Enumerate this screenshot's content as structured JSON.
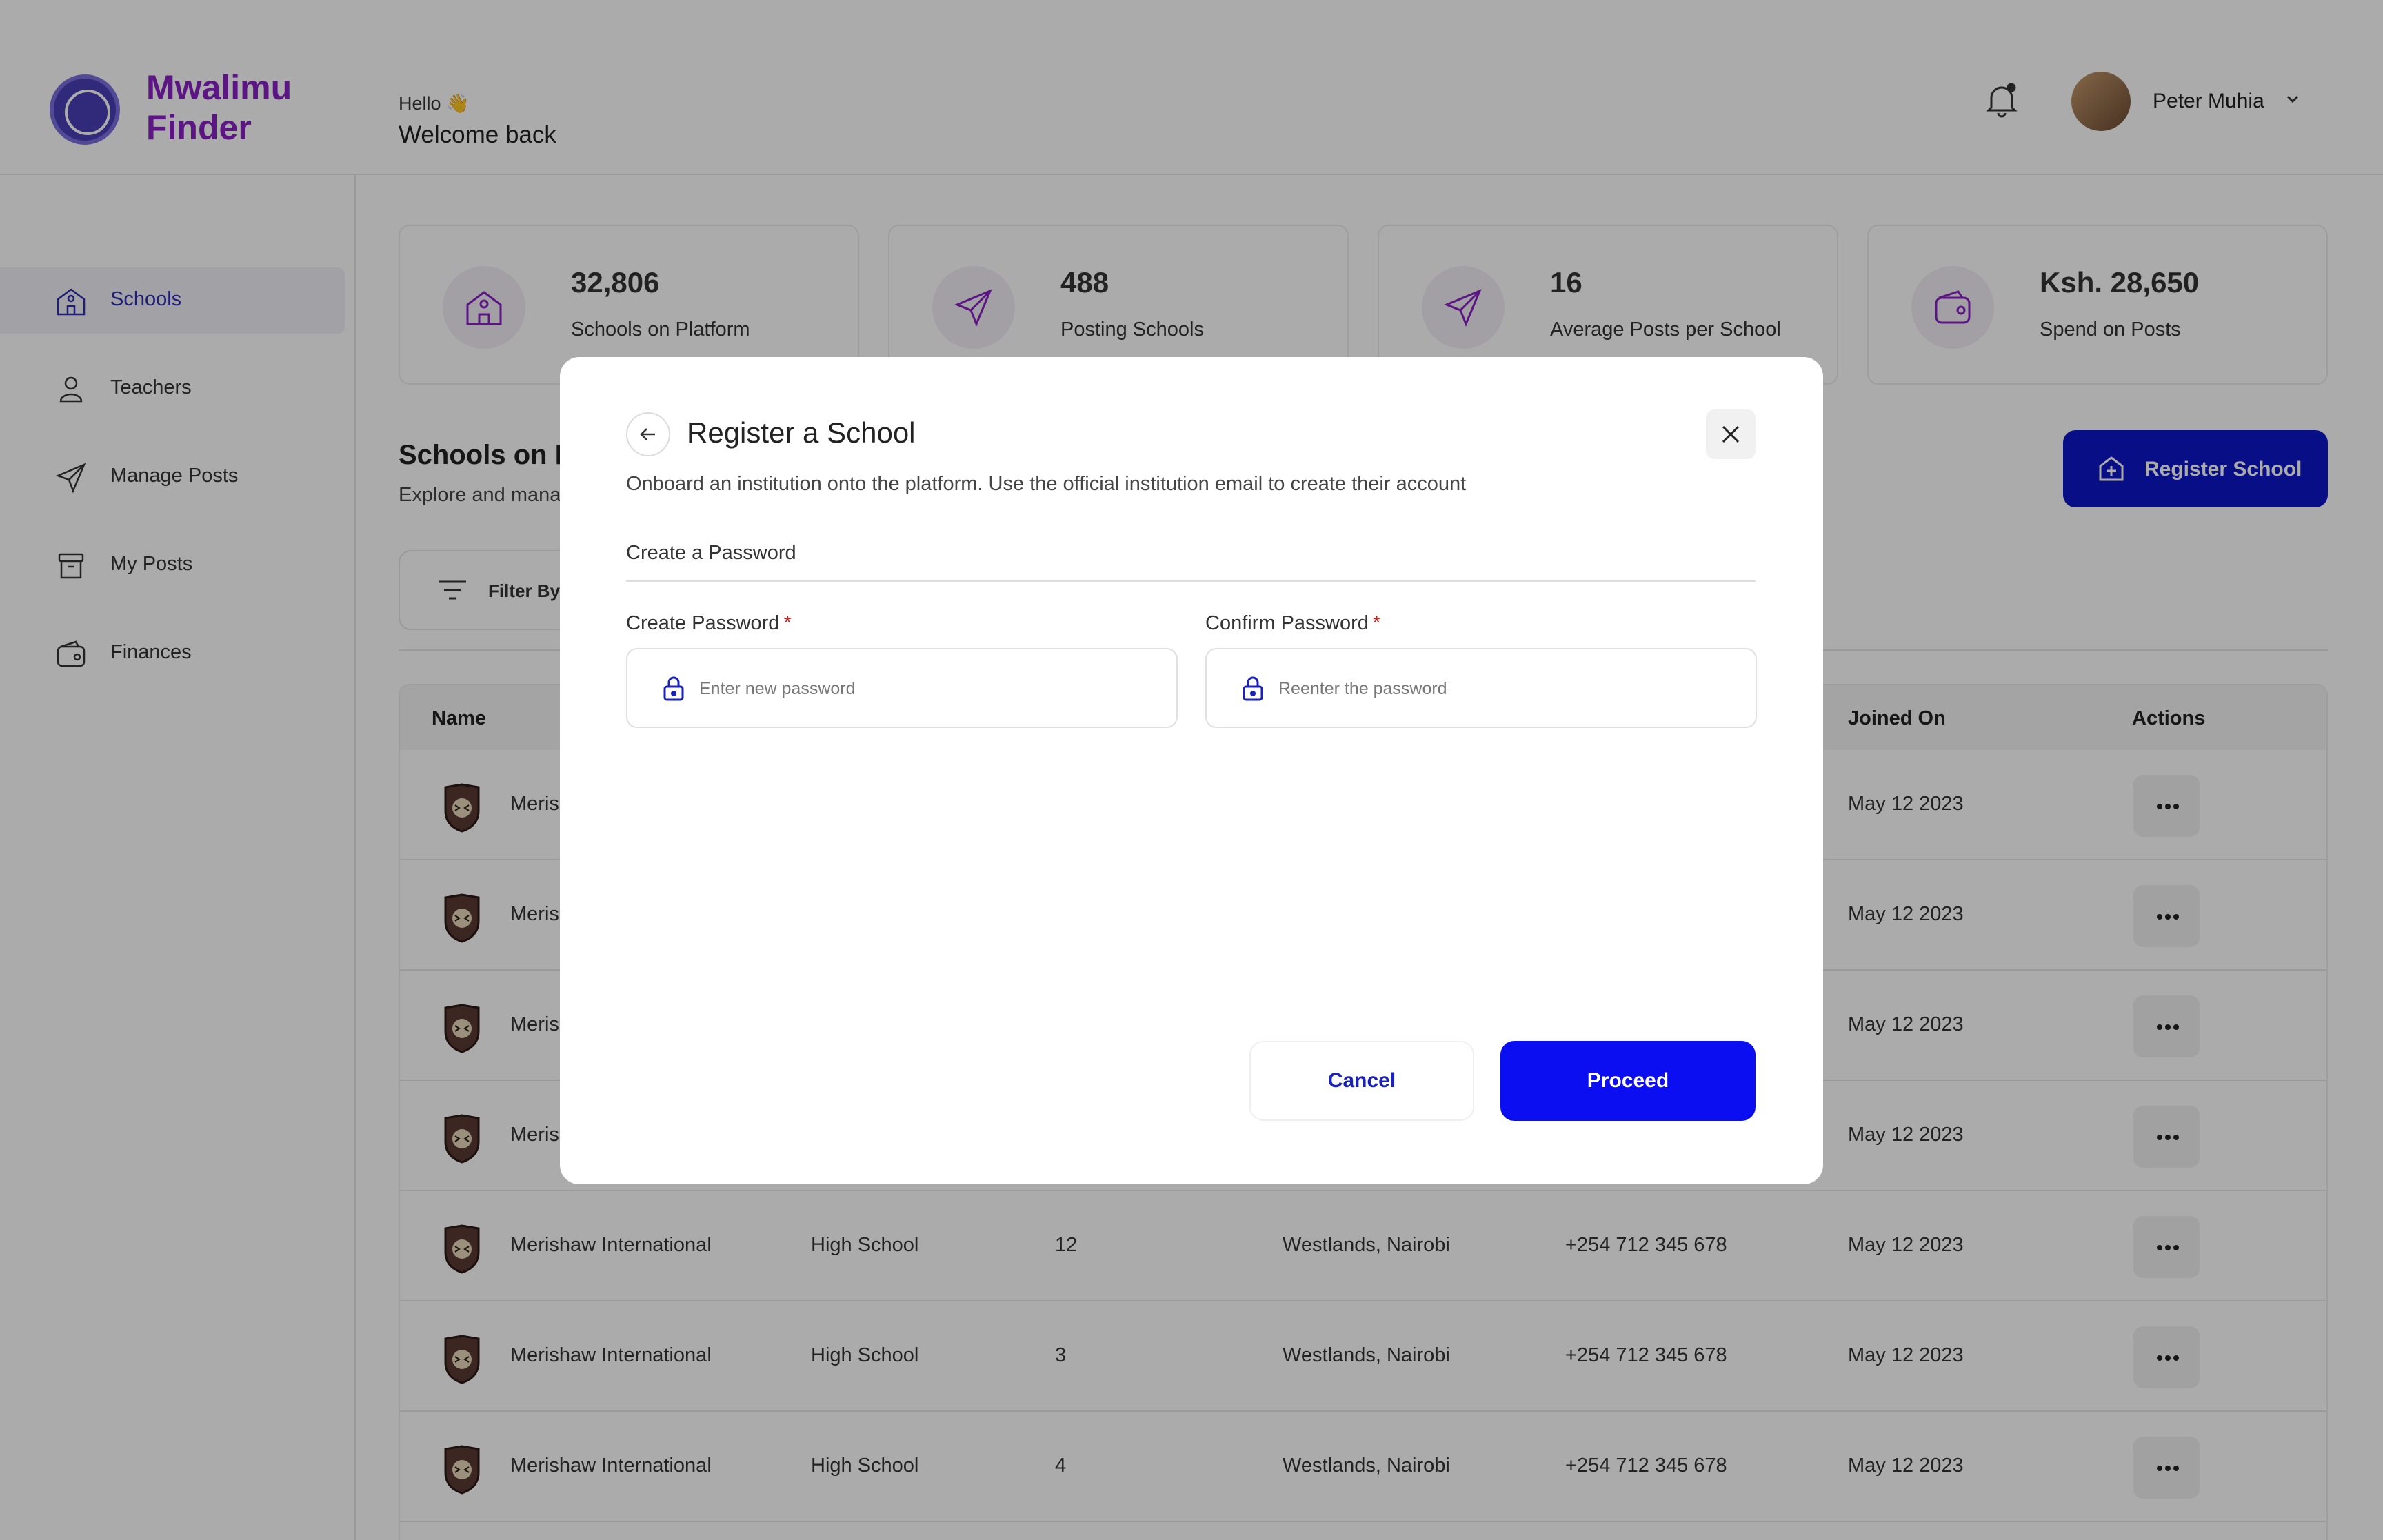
{
  "brand": {
    "name": "Mwalimu Finder"
  },
  "header": {
    "greeting_small": "Hello 👋",
    "greeting_big": "Welcome back",
    "user_name": "Peter Muhia"
  },
  "sidebar": {
    "items": [
      {
        "label": "Schools",
        "icon": "school-icon",
        "active": true
      },
      {
        "label": "Teachers",
        "icon": "user-icon",
        "active": false
      },
      {
        "label": "Manage Posts",
        "icon": "send-icon",
        "active": false
      },
      {
        "label": "My Posts",
        "icon": "archive-icon",
        "active": false
      },
      {
        "label": "Finances",
        "icon": "wallet-icon",
        "active": false
      }
    ]
  },
  "stats": [
    {
      "value": "32,806",
      "label": "Schools on Platform",
      "icon": "school-icon"
    },
    {
      "value": "488",
      "label": "Posting Schools",
      "icon": "send-icon"
    },
    {
      "value": "16",
      "label": "Average Posts per School",
      "icon": "send-icon"
    },
    {
      "value": "Ksh. 28,650",
      "label": "Spend on Posts",
      "icon": "wallet-icon"
    }
  ],
  "section": {
    "title": "Schools on P",
    "subtitle": "Explore and mana",
    "register_label": "Register School",
    "filter_label": "Filter By"
  },
  "table": {
    "headers": {
      "name": "Name",
      "joined": "Joined On",
      "actions": "Actions"
    },
    "rows": [
      {
        "name": "Meris",
        "level": "",
        "posts": "",
        "location": "",
        "phone": "",
        "joined": "May 12 2023"
      },
      {
        "name": "Meris",
        "level": "",
        "posts": "",
        "location": "",
        "phone": "",
        "joined": "May 12 2023"
      },
      {
        "name": "Meris",
        "level": "",
        "posts": "",
        "location": "",
        "phone": "",
        "joined": "May 12 2023"
      },
      {
        "name": "Meris",
        "level": "",
        "posts": "",
        "location": "",
        "phone": "",
        "joined": "May 12 2023"
      },
      {
        "name": "Merishaw International",
        "level": "High School",
        "posts": "12",
        "location": "Westlands, Nairobi",
        "phone": "+254 712 345 678",
        "joined": "May 12 2023"
      },
      {
        "name": "Merishaw International",
        "level": "High School",
        "posts": "3",
        "location": "Westlands, Nairobi",
        "phone": "+254 712 345 678",
        "joined": "May 12 2023"
      },
      {
        "name": "Merishaw International",
        "level": "High School",
        "posts": "4",
        "location": "Westlands, Nairobi",
        "phone": "+254 712 345 678",
        "joined": "May 12 2023"
      }
    ]
  },
  "modal": {
    "title": "Register a School",
    "subtitle": "Onboard an institution onto the platform.  Use the official institution email to create their account",
    "step_label": "Create a Password",
    "password_label": "Create Password",
    "password_placeholder": "Enter new password",
    "confirm_label": "Confirm Password",
    "confirm_placeholder": "Reenter the password",
    "required_mark": "*",
    "cancel_label": "Cancel",
    "proceed_label": "Proceed"
  },
  "colors": {
    "brand": "#8a22c5",
    "primary": "#0d16c8",
    "proceed": "#0a0ef0",
    "required": "#d12020"
  }
}
